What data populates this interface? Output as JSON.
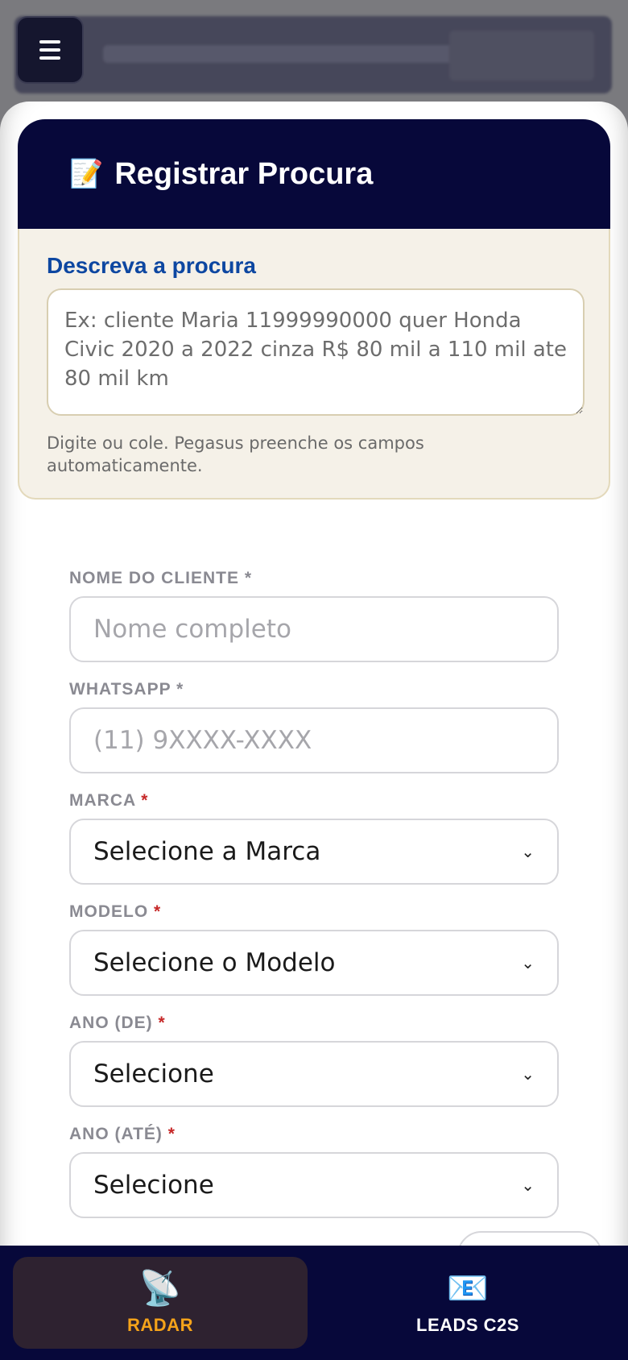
{
  "topbar": {
    "menu_icon": "hamburger-icon"
  },
  "sheet": {
    "title_icon": "memo-icon",
    "title": "Registrar Procura",
    "describe": {
      "label": "Descreva a procura",
      "placeholder": "Ex: cliente Maria 11999990000 quer Honda Civic 2020 a 2022 cinza R$ 80 mil a 110 mil ate 80 mil km",
      "value": "",
      "hint": "Digite ou cole. Pegasus preenche os campos automaticamente."
    },
    "fields": {
      "nome": {
        "label": "NOME DO CLIENTE",
        "required_mark": "*",
        "placeholder": "Nome completo"
      },
      "whatsapp": {
        "label": "WHATSAPP",
        "required_mark": "*",
        "placeholder": "(11) 9XXXX-XXXX"
      },
      "marca": {
        "label": "MARCA",
        "required_mark": "*",
        "selected": "Selecione a Marca"
      },
      "modelo": {
        "label": "MODELO",
        "required_mark": "*",
        "selected": "Selecione o Modelo"
      },
      "ano_de": {
        "label": "ANO (DE)",
        "required_mark": "*",
        "selected": "Selecione"
      },
      "ano_ate": {
        "label": "ANO (ATÉ)",
        "required_mark": "*",
        "selected": "Selecione"
      }
    }
  },
  "bottom_nav": {
    "items": [
      {
        "label": "RADAR",
        "icon": "satellite-dish-icon",
        "active": true
      },
      {
        "label": "LEADS C2S",
        "icon": "envelope-icon",
        "active": false
      }
    ]
  },
  "colors": {
    "navy": "#07083a",
    "accent_orange": "#f5a31a",
    "label_blue": "#0d47a1",
    "required_red": "#c62828"
  }
}
